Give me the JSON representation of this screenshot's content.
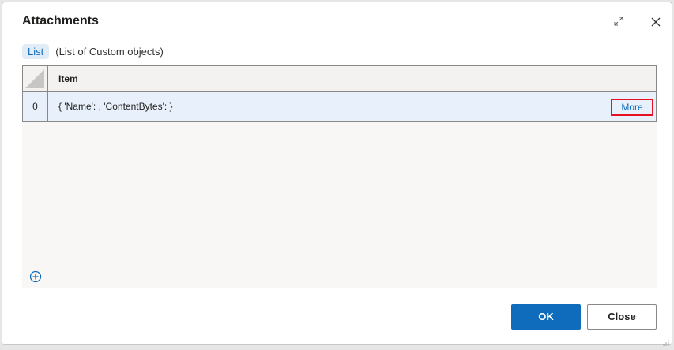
{
  "dialog": {
    "title": "Attachments",
    "expand_icon": "expand-icon",
    "close_icon": "close-icon"
  },
  "variable": {
    "type_badge": "List",
    "type_description": "(List of Custom objects)"
  },
  "grid": {
    "column_header": "Item",
    "rows": [
      {
        "index": "0",
        "value": "{ 'Name': , 'ContentBytes': }",
        "action_label": "More"
      }
    ],
    "add_icon": "plus-circle-icon"
  },
  "footer": {
    "ok_label": "OK",
    "close_label": "Close"
  },
  "colors": {
    "accent": "#0f6cbd",
    "highlight_border": "#e81123",
    "selected_row": "#e8f1fb"
  }
}
